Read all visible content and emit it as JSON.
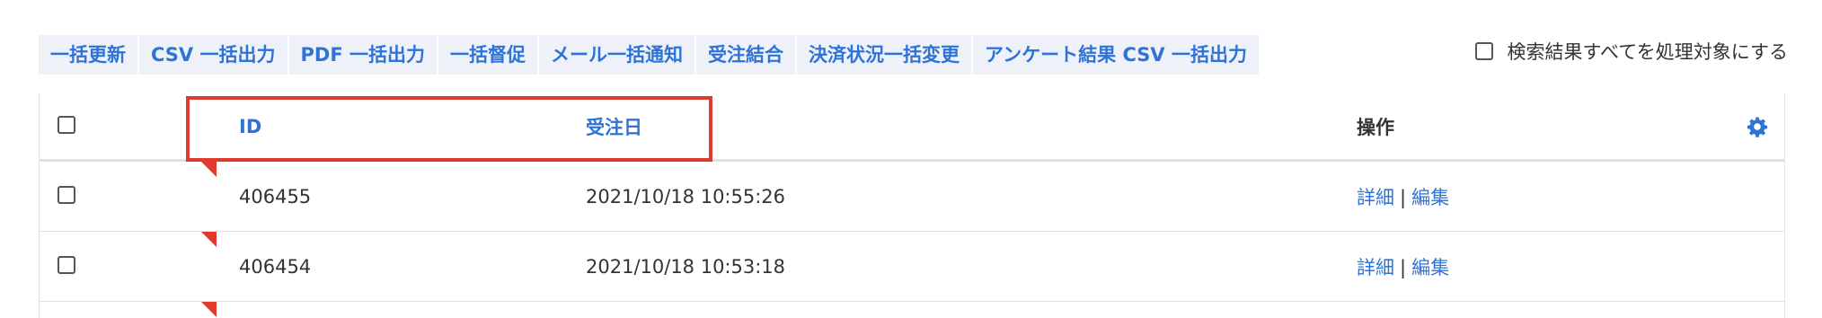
{
  "bulk_actions": [
    {
      "label": "一括更新"
    },
    {
      "label": "CSV 一括出力"
    },
    {
      "label": "PDF 一括出力"
    },
    {
      "label": "一括督促"
    },
    {
      "label": "メール一括通知"
    },
    {
      "label": "受注結合"
    },
    {
      "label": "決済状況一括変更"
    },
    {
      "label": "アンケート結果 CSV 一括出力"
    }
  ],
  "select_all": {
    "label": "検索結果すべてを処理対象にする",
    "checked": false
  },
  "table": {
    "columns": {
      "id": "ID",
      "order_date": "受注日",
      "operations": "操作"
    },
    "settings_icon": "gear-icon",
    "rows": [
      {
        "id": "406455",
        "order_date": "2021/10/18 10:55:26",
        "detail": "詳細",
        "separator": "|",
        "edit": "編集"
      },
      {
        "id": "406454",
        "order_date": "2021/10/18 10:53:18",
        "detail": "詳細",
        "separator": "|",
        "edit": "編集"
      }
    ]
  },
  "colors": {
    "accent": "#2f73d6",
    "annotation_red": "#e03a2f",
    "toolbar_bg": "#eef2f8"
  }
}
